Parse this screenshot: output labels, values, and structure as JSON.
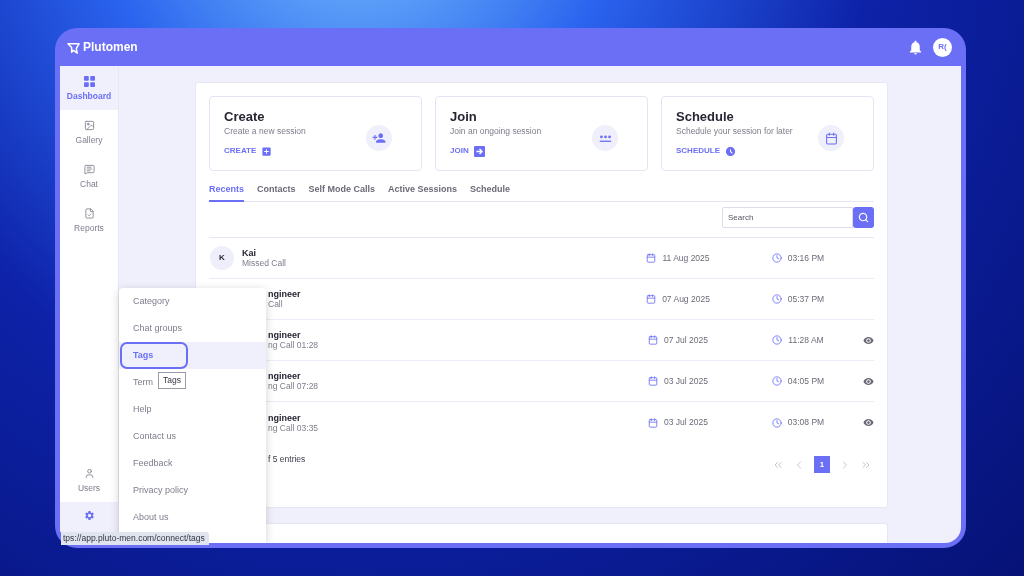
{
  "header": {
    "logo_text": "Plutomen",
    "avatar_initials": "R("
  },
  "sidebar": {
    "items": [
      {
        "label": "Dashboard",
        "selected": true
      },
      {
        "label": "Gallery",
        "selected": false
      },
      {
        "label": "Chat",
        "selected": false
      },
      {
        "label": "Reports",
        "selected": false
      }
    ],
    "bottom_items": [
      {
        "label": "Users",
        "selected": false
      }
    ],
    "settings": {
      "menu_open": true
    }
  },
  "actions": [
    {
      "title": "Create",
      "subtitle": "Create a new session",
      "link": "CREATE"
    },
    {
      "title": "Join",
      "subtitle": "Join an ongoing session",
      "link": "JOIN"
    },
    {
      "title": "Schedule",
      "subtitle": "Schedule your session for later",
      "link": "SCHEDULE"
    }
  ],
  "tabs": [
    {
      "label": "Recents",
      "selected": true
    },
    {
      "label": "Contacts",
      "selected": false
    },
    {
      "label": "Self Mode Calls",
      "selected": false
    },
    {
      "label": "Active Sessions",
      "selected": false
    },
    {
      "label": "Schedule",
      "selected": false
    }
  ],
  "search": {
    "placeholder": "Search"
  },
  "rows": [
    {
      "avatar": "K",
      "name": "Kai",
      "detail": "Missed Call",
      "date": "11 Aug 2025",
      "time": "03:16 PM",
      "viewable": false
    },
    {
      "name": "ngineer",
      "detail": "Call",
      "date": "07 Aug 2025",
      "time": "05:37 PM",
      "viewable": false
    },
    {
      "name": "ngineer",
      "detail": "ng Call 01:28",
      "date": "07 Jul 2025",
      "time": "11:28 AM",
      "viewable": true
    },
    {
      "name": "ngineer",
      "detail": "ng Call 07:28",
      "date": "03 Jul 2025",
      "time": "04:05 PM",
      "viewable": true
    },
    {
      "name": "ngineer",
      "detail": "ng Call 03:35",
      "date": "03 Jul 2025",
      "time": "03:08 PM",
      "viewable": true
    }
  ],
  "table_footer": {
    "entries": "f 5 entries"
  },
  "pagination": {
    "pages": [
      {
        "label": "1",
        "selected": true
      }
    ]
  },
  "settings_menu": {
    "items": [
      {
        "label": "Category",
        "selected": false
      },
      {
        "label": "Chat groups",
        "selected": false
      },
      {
        "label": "Tags",
        "selected": true
      },
      {
        "label": "Term",
        "selected": false
      },
      {
        "label": "Help",
        "selected": false
      },
      {
        "label": "Contact us",
        "selected": false
      },
      {
        "label": "Feedback",
        "selected": false
      },
      {
        "label": "Privacy policy",
        "selected": false
      },
      {
        "label": "About us",
        "selected": false
      }
    ],
    "tooltip": "Tags"
  },
  "status_bar": {
    "url": "tps://app.pluto-men.com/connect/tags"
  }
}
